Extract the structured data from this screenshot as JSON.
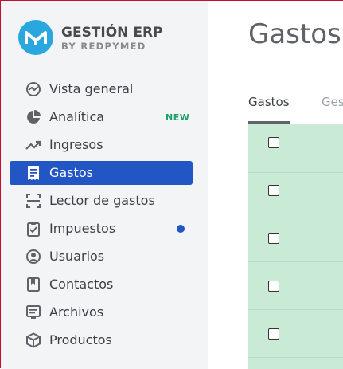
{
  "brand": {
    "title": "GESTIÓN ERP",
    "subtitle": "BY REDPYMED",
    "accent": "#2aa7df"
  },
  "sidebar": {
    "items": [
      {
        "label": "Vista general",
        "icon": "gauge-icon"
      },
      {
        "label": "Analítica",
        "icon": "pie-chart-icon",
        "badge": "NEW"
      },
      {
        "label": "Ingresos",
        "icon": "trending-up-icon"
      },
      {
        "label": "Gastos",
        "icon": "receipt-icon",
        "active": true
      },
      {
        "label": "Lector de gastos",
        "icon": "scan-icon"
      },
      {
        "label": "Impuestos",
        "icon": "clipboard-check-icon",
        "dot": true
      },
      {
        "label": "Usuarios",
        "icon": "user-circle-icon"
      },
      {
        "label": "Contactos",
        "icon": "bookmark-icon"
      },
      {
        "label": "Archivos",
        "icon": "document-icon"
      },
      {
        "label": "Productos",
        "icon": "cube-icon"
      }
    ],
    "active_color": "#2256c4",
    "new_badge_color": "#1e9e6a"
  },
  "main": {
    "title": "Gastos",
    "tabs": [
      {
        "label": "Gastos",
        "active": true
      },
      {
        "label": "Ges"
      }
    ],
    "rows": 5,
    "row_color": "#c9ebd6"
  }
}
